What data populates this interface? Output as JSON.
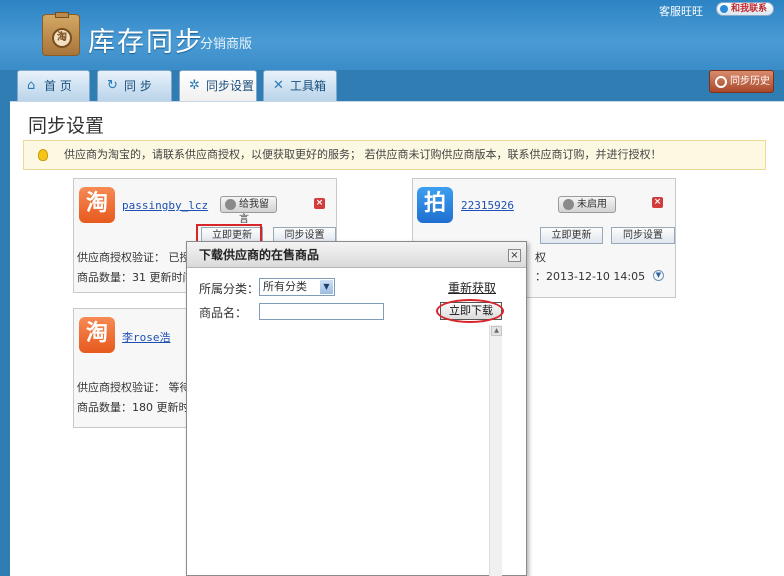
{
  "header": {
    "app_title": "库存同步",
    "app_subtitle": "分销商版",
    "logo_glyph": "淘",
    "service_label": "客服旺旺",
    "contact_label": "和我联系"
  },
  "tabs": [
    {
      "label": "首 页",
      "icon": "home-icon",
      "glyph": "⌂"
    },
    {
      "label": "同 步",
      "icon": "refresh-icon",
      "glyph": "↻"
    },
    {
      "label": "同步设置",
      "icon": "gear-icon",
      "glyph": "✲"
    },
    {
      "label": "工具箱",
      "icon": "tools-icon",
      "glyph": "✕"
    }
  ],
  "history_button": "同步历史",
  "page_title": "同步设置",
  "notice": "供应商为淘宝的，请联系供应商授权，以便获取更好的服务；  若供应商未订购供应商版本，联系供应商订购，并进行授权！",
  "suppliers": {
    "s1": {
      "icon_glyph": "淘",
      "name": "passingby_lcz",
      "pill": "给我留言",
      "update_btn": "立即更新",
      "settings_btn": "同步设置",
      "auth_line": "供应商授权验证：  已授",
      "count_line": "商品数量：31  更新时间"
    },
    "s2": {
      "icon_glyph": "拍",
      "name": "22315926",
      "pill": "未启用",
      "update_btn": "立即更新",
      "settings_btn": "同步设置",
      "auth_line": "权",
      "count_line": "：2013-12-10 14:05"
    },
    "s3": {
      "icon_glyph": "淘",
      "name": "李rose浩",
      "auth_line": "供应商授权验证：  等待",
      "count_line": "商品数量：180  更新时间"
    }
  },
  "modal": {
    "title": "下载供应商的在售商品",
    "close": "×",
    "category_label": "所属分类：",
    "category_value": "所有分类",
    "refresh_link": "重新获取",
    "product_label": "商品名：",
    "product_value": "",
    "download_btn": "立即下载"
  },
  "colors": {
    "header_blue": "#3a8cc8",
    "highlight_red": "#d6252b",
    "taobao_orange": "#e65a1e",
    "paipai_blue": "#1f6fd0"
  }
}
